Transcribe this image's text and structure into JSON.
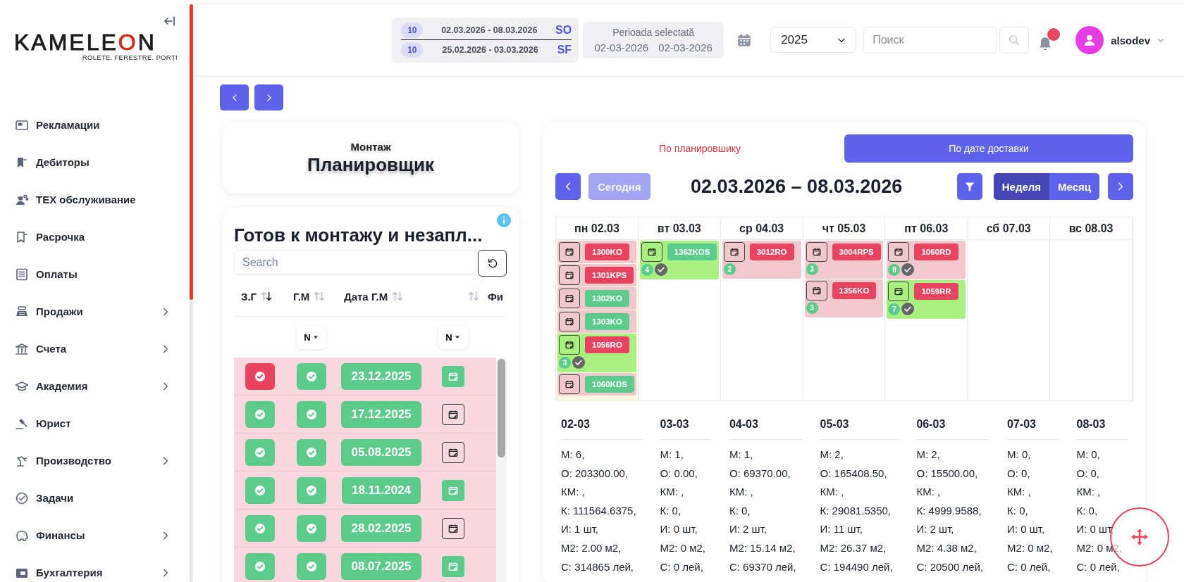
{
  "sidebar": {
    "logo": {
      "name": "KAMELEON",
      "tagline": "ROLETE. FERESTRE. PORȚI"
    },
    "items": [
      {
        "label": "Рекламации",
        "expandable": false
      },
      {
        "label": "Дебиторы",
        "expandable": false
      },
      {
        "label": "ТЕХ обслуживание",
        "expandable": false
      },
      {
        "label": "Расрочка",
        "expandable": false
      },
      {
        "label": "Оплаты",
        "expandable": false
      },
      {
        "label": "Продажи",
        "expandable": true
      },
      {
        "label": "Счета",
        "expandable": true
      },
      {
        "label": "Академия",
        "expandable": true
      },
      {
        "label": "Юрист",
        "expandable": false
      },
      {
        "label": "Производство",
        "expandable": true
      },
      {
        "label": "Задачи",
        "expandable": false
      },
      {
        "label": "Финансы",
        "expandable": true
      },
      {
        "label": "Бухгалтерия",
        "expandable": true
      }
    ]
  },
  "header": {
    "date_ranges": [
      {
        "count": "10",
        "range": "02.03.2026 - 08.03.2026",
        "code": "SO"
      },
      {
        "count": "10",
        "range": "25.02.2026 - 03.03.2026",
        "code": "SF"
      }
    ],
    "period": {
      "title": "Perioada selectată",
      "from": "02-03-2026",
      "to": "02-03-2026"
    },
    "year": "2025",
    "search": {
      "placeholder": "Поиск"
    },
    "notifications": {
      "unread": true
    },
    "user": "alsodev"
  },
  "planner": {
    "subtitle": "Монтаж",
    "title": "Планировщик"
  },
  "ready_table": {
    "title": "Готов к монтажу и незапл...",
    "search": {
      "placeholder": "Search"
    },
    "columns": [
      {
        "label": "З.Г",
        "sorted": true
      },
      {
        "label": "Г.М",
        "sorted": false,
        "filter": "N"
      },
      {
        "label": "Дата Г.М",
        "sorted": false
      },
      {
        "sorted": false,
        "filter": "N"
      },
      {
        "label": "Фи"
      }
    ],
    "rows": [
      {
        "zg_ok": false,
        "gm_ok": true,
        "date": "23.12.2025",
        "scheduled": true
      },
      {
        "zg_ok": true,
        "gm_ok": true,
        "date": "17.12.2025",
        "scheduled": false
      },
      {
        "zg_ok": true,
        "gm_ok": true,
        "date": "05.08.2025",
        "scheduled": false
      },
      {
        "zg_ok": true,
        "gm_ok": true,
        "date": "18.11.2024",
        "scheduled": true
      },
      {
        "zg_ok": true,
        "gm_ok": true,
        "date": "28.02.2025",
        "scheduled": false
      },
      {
        "zg_ok": true,
        "gm_ok": true,
        "date": "08.07.2025",
        "scheduled": true
      }
    ]
  },
  "calendar": {
    "tabs": [
      {
        "label": "По планировшику",
        "selected": false
      },
      {
        "label": "По дате доставки",
        "selected": true
      }
    ],
    "today_button": {
      "label": "Сегодня",
      "disabled": true
    },
    "range_title": "02.03.2026 – 08.03.2026",
    "views": [
      {
        "label": "Неделя",
        "selected": true
      },
      {
        "label": "Месяц",
        "selected": false
      }
    ],
    "days": [
      {
        "label": "пн 02.03",
        "today": true,
        "events": [
          {
            "code": "1300KO",
            "color": "#e8445f",
            "highlighted": false,
            "checked": false
          },
          {
            "code": "1301KPS",
            "color": "#e8445f",
            "highlighted": false,
            "checked": false
          },
          {
            "code": "1302KO",
            "color": "#5ccb8c",
            "highlighted": false,
            "checked": false
          },
          {
            "code": "1303KO",
            "color": "#5ccb8c",
            "highlighted": false,
            "checked": false
          },
          {
            "code": "1056RO",
            "color": "#e8445f",
            "highlighted": true,
            "count": "3",
            "checked": true
          },
          {
            "code": "1060KDS",
            "color": "#5ccb8c",
            "highlighted": false,
            "checked": false
          }
        ]
      },
      {
        "label": "вт 03.03",
        "today": false,
        "events": [
          {
            "code": "1362KOS",
            "color": "#5ccb8c",
            "highlighted": true,
            "count": "4",
            "checked": true
          }
        ]
      },
      {
        "label": "ср 04.03",
        "today": false,
        "events": [
          {
            "code": "3012RO",
            "color": "#e8445f",
            "highlighted": false,
            "count": "2",
            "checked": false
          }
        ]
      },
      {
        "label": "чт 05.03",
        "today": false,
        "events": [
          {
            "code": "3004RPS",
            "color": "#e8445f",
            "highlighted": false,
            "count": "3",
            "checked": false
          },
          {
            "code": "1356KO",
            "color": "#e8445f",
            "highlighted": false,
            "count": "3",
            "checked": false
          }
        ]
      },
      {
        "label": "пт 06.03",
        "today": false,
        "events": [
          {
            "code": "1060RD",
            "color": "#e8445f",
            "highlighted": false,
            "count": "8",
            "checked": true
          },
          {
            "code": "1059RR",
            "color": "#e8445f",
            "highlighted": true,
            "count": "7",
            "checked": true
          }
        ]
      },
      {
        "label": "сб 07.03",
        "today": false
      },
      {
        "label": "вс 08.03",
        "today": false
      }
    ],
    "summary": [
      {
        "day": "02-03",
        "lines": [
          "М: 6,",
          "О: 203300.00,",
          "КМ: ,",
          "К: 111564.6375,",
          "И: 1 шт,",
          "М2: 2.00 м2,",
          "С: 314865 лей,"
        ]
      },
      {
        "day": "03-03",
        "lines": [
          "М: 1,",
          "О: 0.00,",
          "КМ: ,",
          "К: 0,",
          "И: 0 шт,",
          "М2: 0 м2,",
          "С: 0 лей,"
        ]
      },
      {
        "day": "04-03",
        "lines": [
          "М: 1,",
          "О: 69370.00,",
          "КМ: ,",
          "К: 0,",
          "И: 2 шт,",
          "М2: 15.14 м2,",
          "С: 69370 лей,"
        ]
      },
      {
        "day": "05-03",
        "lines": [
          "М: 2,",
          "О: 165408.50,",
          "КМ: ,",
          "К: 29081.5350,",
          "И: 11 шт,",
          "М2: 26.37 м2,",
          "С: 194490 лей,"
        ]
      },
      {
        "day": "06-03",
        "lines": [
          "М: 2,",
          "О: 15500.00,",
          "КМ: ,",
          "К: 4999.9588,",
          "И: 2 шт,",
          "М2: 4.38 м2,",
          "С: 20500 лей,"
        ]
      },
      {
        "day": "07-03",
        "lines": [
          "М: 0,",
          "О: 0,",
          "КМ: ,",
          "К: 0,",
          "И: 0 шт,",
          "М2: 0 м2,",
          "С: 0 лей,"
        ]
      },
      {
        "day": "08-03",
        "lines": [
          "М: 0,",
          "О: 0,",
          "КМ: ,",
          "К: 0,",
          "И: 0 шт,",
          "М2: 0 м2,",
          "С: 0 лей,"
        ]
      }
    ]
  }
}
